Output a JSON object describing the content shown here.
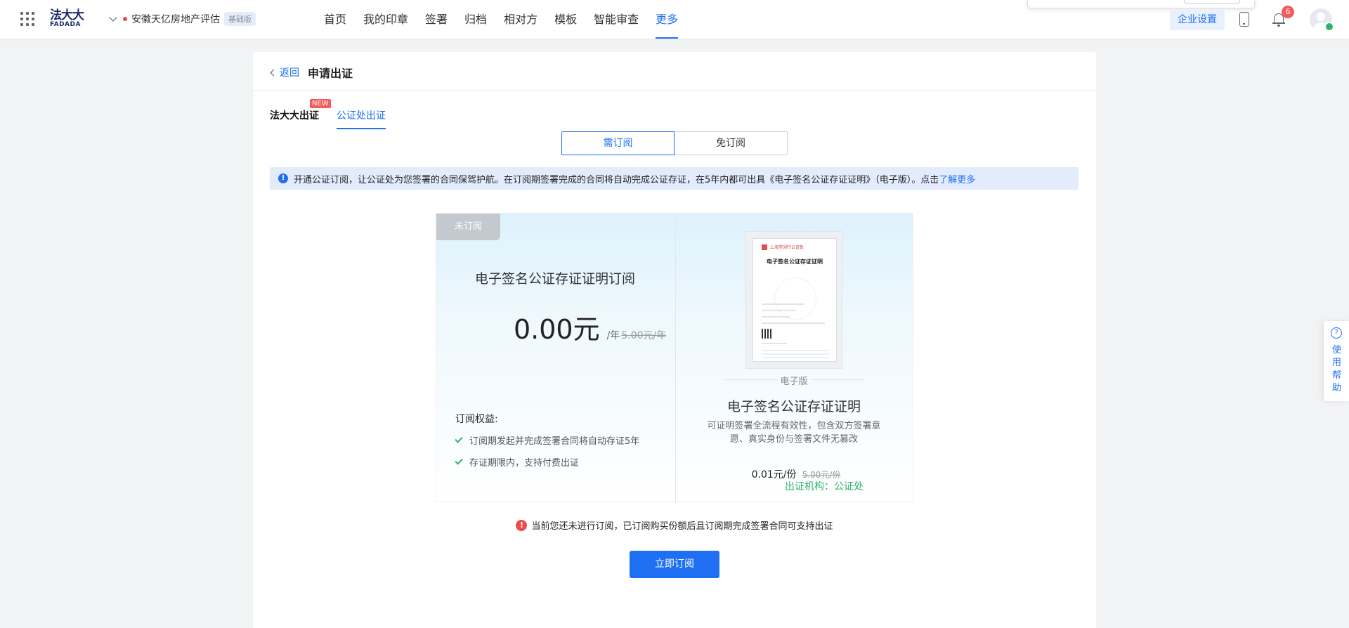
{
  "brand": {
    "logo_cn": "法大大",
    "logo_en": "FADADA"
  },
  "org": {
    "name": "安徽天亿房地产评估",
    "tier": "基础版"
  },
  "nav": {
    "items": [
      "首页",
      "我的印章",
      "签署",
      "归档",
      "相对方",
      "模板",
      "智能审查",
      "更多"
    ],
    "active_index": 7
  },
  "header": {
    "enterprise_settings": "企业设置",
    "notification_count": "6"
  },
  "page": {
    "back_label": "返回",
    "title": "申请出证"
  },
  "tabs": [
    {
      "label": "法大大出证",
      "tag": "NEW"
    },
    {
      "label": "公证处出证",
      "active": true
    }
  ],
  "segments": {
    "option_a": "需订阅",
    "option_b": "免订阅",
    "selected": "需订阅"
  },
  "notice": {
    "text": "开通公证订阅，让公证处为您签署的合同保驾护航。在订阅期签署完成的合同将自动完成公证存证，在5年内都可出具《电子签名公证存证证明》（电子版）。点击",
    "link": "了解更多"
  },
  "plan": {
    "status_tag": "未订阅",
    "title": "电子签名公证存证证明订阅",
    "price": "0.00元",
    "unit": "/年",
    "original_price": "5.00元/年",
    "benefits_label": "订阅权益:",
    "benefits": [
      "订阅期发起并完成签署合同将自动存证5年",
      "存证期限内，支持付费出证"
    ]
  },
  "certificate": {
    "org_on_doc": "上海市闵行公证处",
    "doc_title": "电子签名公证存证证明",
    "version": "电子版",
    "title": "电子签名公证存证证明",
    "description": "可证明签署全流程有效性，包含双方签署意愿、真实身份与签署文件无篡改",
    "issuer_label": "出证机构：公证处",
    "price": "0.01元/份",
    "original_price": "5.00元/份"
  },
  "warning": "当前您还未进行订阅，已订阅购买份额后且订阅期完成签署合同可支持出证",
  "actions": {
    "subscribe": "立即订阅"
  },
  "help": {
    "label": "使用帮助"
  },
  "colors": {
    "primary": "#1f6ff2",
    "success": "#2fb26a",
    "danger": "#f45b5b"
  }
}
